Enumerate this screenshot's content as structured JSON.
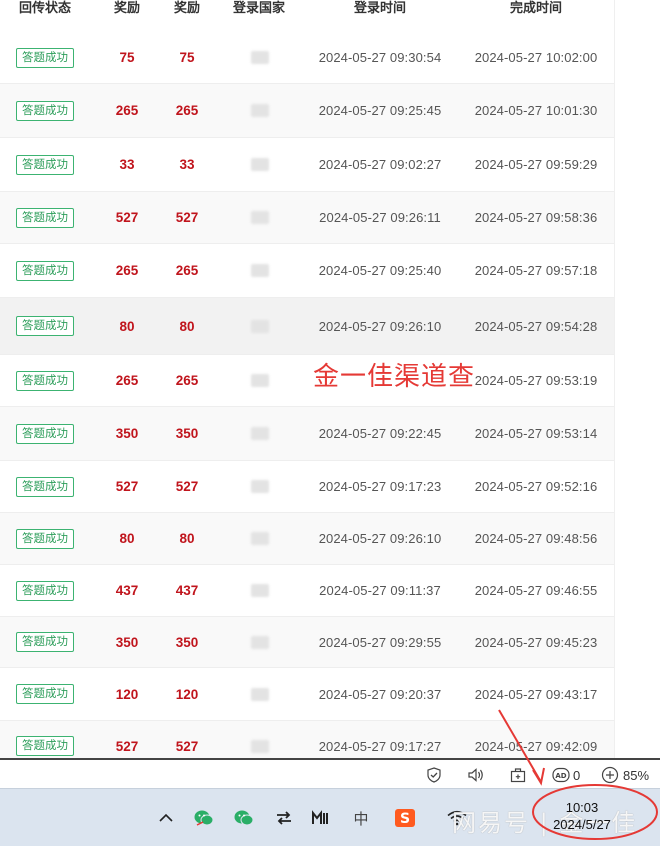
{
  "table": {
    "headers": [
      "回传状态",
      "奖励",
      "奖励",
      "登录国家",
      "登录时间",
      "完成时间"
    ],
    "rows": [
      {
        "status": "答题成功",
        "reward1": "75",
        "reward2": "75",
        "login": "2024-05-27 09:30:54",
        "done": "2024-05-27 10:02:00"
      },
      {
        "status": "答题成功",
        "reward1": "265",
        "reward2": "265",
        "login": "2024-05-27 09:25:45",
        "done": "2024-05-27 10:01:30"
      },
      {
        "status": "答题成功",
        "reward1": "33",
        "reward2": "33",
        "login": "2024-05-27 09:02:27",
        "done": "2024-05-27 09:59:29"
      },
      {
        "status": "答题成功",
        "reward1": "527",
        "reward2": "527",
        "login": "2024-05-27 09:26:11",
        "done": "2024-05-27 09:58:36"
      },
      {
        "status": "答题成功",
        "reward1": "265",
        "reward2": "265",
        "login": "2024-05-27 09:25:40",
        "done": "2024-05-27 09:57:18"
      },
      {
        "status": "答题成功",
        "reward1": "80",
        "reward2": "80",
        "login": "2024-05-27 09:26:10",
        "done": "2024-05-27 09:54:28"
      },
      {
        "status": "答题成功",
        "reward1": "265",
        "reward2": "265",
        "login": "",
        "done": "2024-05-27 09:53:19"
      },
      {
        "status": "答题成功",
        "reward1": "350",
        "reward2": "350",
        "login": "2024-05-27 09:22:45",
        "done": "2024-05-27 09:53:14"
      },
      {
        "status": "答题成功",
        "reward1": "527",
        "reward2": "527",
        "login": "2024-05-27 09:17:23",
        "done": "2024-05-27 09:52:16"
      },
      {
        "status": "答题成功",
        "reward1": "80",
        "reward2": "80",
        "login": "2024-05-27 09:26:10",
        "done": "2024-05-27 09:48:56"
      },
      {
        "status": "答题成功",
        "reward1": "437",
        "reward2": "437",
        "login": "2024-05-27 09:11:37",
        "done": "2024-05-27 09:46:55"
      },
      {
        "status": "答题成功",
        "reward1": "350",
        "reward2": "350",
        "login": "2024-05-27 09:29:55",
        "done": "2024-05-27 09:45:23"
      },
      {
        "status": "答题成功",
        "reward1": "120",
        "reward2": "120",
        "login": "2024-05-27 09:20:37",
        "done": "2024-05-27 09:43:17"
      },
      {
        "status": "答题成功",
        "reward1": "527",
        "reward2": "527",
        "login": "2024-05-27 09:17:27",
        "done": "2024-05-27 09:42:09"
      }
    ]
  },
  "watermark": "金一佳渠道查",
  "status_strip": {
    "ad_count": "0",
    "zoom": "85%"
  },
  "taskbar": {
    "ime_label": "中",
    "brand": "网易号 | 金一佳",
    "clock_time": "10:03",
    "clock_date": "2024/5/27"
  },
  "colors": {
    "reward_red": "#c0141c",
    "badge_green": "#2e9e5b",
    "annotation_red": "#e53935",
    "taskbar_bg": "#dbe4ef"
  }
}
